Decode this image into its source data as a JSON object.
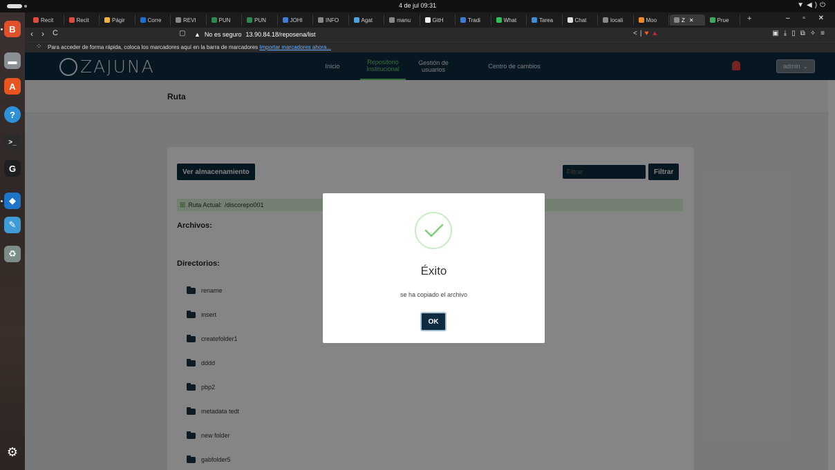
{
  "os": {
    "clock": "4 de jul 09:31",
    "tray_icons": [
      "wifi-icon",
      "volume-icon",
      "power-icon"
    ]
  },
  "dock": {
    "apps": [
      {
        "name": "brave-icon",
        "color": "#e0512b",
        "glyph": "B"
      },
      {
        "name": "files-icon",
        "color": "#8a8f94",
        "glyph": "▬"
      },
      {
        "name": "app-center-icon",
        "color": "#e95420",
        "glyph": "A"
      },
      {
        "name": "help-icon",
        "color": "#2e90d6",
        "glyph": "?"
      },
      {
        "name": "terminal-icon",
        "color": "#2b2b2b",
        "glyph": ">_"
      },
      {
        "name": "gitkraken-icon",
        "color": "#1d1f21",
        "glyph": "G"
      },
      {
        "name": "vscode-icon",
        "color": "#1e75c7",
        "glyph": "◆"
      },
      {
        "name": "text-editor-icon",
        "color": "#3f9bd6",
        "glyph": "✎"
      },
      {
        "name": "trash-icon",
        "color": "#7a8d86",
        "glyph": "♻"
      }
    ],
    "show_apps_glyph": "⚙"
  },
  "browser": {
    "tabs": [
      {
        "label": "Recit",
        "icon_color": "#e04a3a"
      },
      {
        "label": "Recit",
        "icon_color": "#e04a3a"
      },
      {
        "label": "Págir",
        "icon_color": "#f2b233"
      },
      {
        "label": "Corre",
        "icon_color": "#1f6fd1"
      },
      {
        "label": "REVI",
        "icon_color": "#888888"
      },
      {
        "label": "PUN",
        "icon_color": "#2d8a4e"
      },
      {
        "label": "PUN",
        "icon_color": "#2d8a4e"
      },
      {
        "label": "JOHI",
        "icon_color": "#3b7fd6"
      },
      {
        "label": "INFO",
        "icon_color": "#888888"
      },
      {
        "label": "Agat",
        "icon_color": "#4aa3df"
      },
      {
        "label": "manu",
        "icon_color": "#888888"
      },
      {
        "label": "GitH",
        "icon_color": "#f0f0f0"
      },
      {
        "label": "Tradi",
        "icon_color": "#3d7bd6"
      },
      {
        "label": "What",
        "icon_color": "#2fc15a"
      },
      {
        "label": "Tarea",
        "icon_color": "#3b8ed6"
      },
      {
        "label": "Chat",
        "icon_color": "#e0e0e0"
      },
      {
        "label": "locali",
        "icon_color": "#888888"
      },
      {
        "label": "Moo",
        "icon_color": "#f08a24"
      },
      {
        "label": "Z",
        "icon_color": "#888888"
      },
      {
        "label": "Prue",
        "icon_color": "#3aa860"
      }
    ],
    "active_tab_index": 18,
    "new_tab": "+",
    "window_controls": "– ▫ ✕",
    "nav": {
      "back": "‹",
      "forward": "›",
      "reload": "C"
    },
    "security_label": "No es seguro",
    "url": "13.90.84.18/reposena/list",
    "bookmarks_hint": "Para acceder de forma rápida, coloca los marcadores aquí en la barra de marcadores",
    "bookmarks_link": "Importar marcadores ahora..."
  },
  "app": {
    "logo_text": "ZAJUNA",
    "nav": [
      {
        "label": "Inicio",
        "active": false
      },
      {
        "label": "Repositorio Institucional",
        "active": true
      },
      {
        "label": "Gestión de usuarios",
        "active": false
      },
      {
        "label": "Centro de cambios",
        "active": false
      }
    ],
    "user_label": "admin",
    "page_title": "Ruta",
    "buttons": {
      "storage": "Ver almacenamiento",
      "filter": "Filtrar"
    },
    "filter_placeholder": "Filtrar",
    "route_label": "Ruta Actual:",
    "route_value": "/discorepo001",
    "files_heading": "Archivos:",
    "dirs_heading": "Directorios:",
    "directories": [
      "rename",
      "insert",
      "createfolder1",
      "dddd",
      "pbp2",
      "metadata tedt",
      "new folder",
      "gabfolder5"
    ]
  },
  "modal": {
    "title": "Éxito",
    "message": "se ha copiado el archivo",
    "ok_label": "OK",
    "accent_color": "#7bcf74"
  }
}
